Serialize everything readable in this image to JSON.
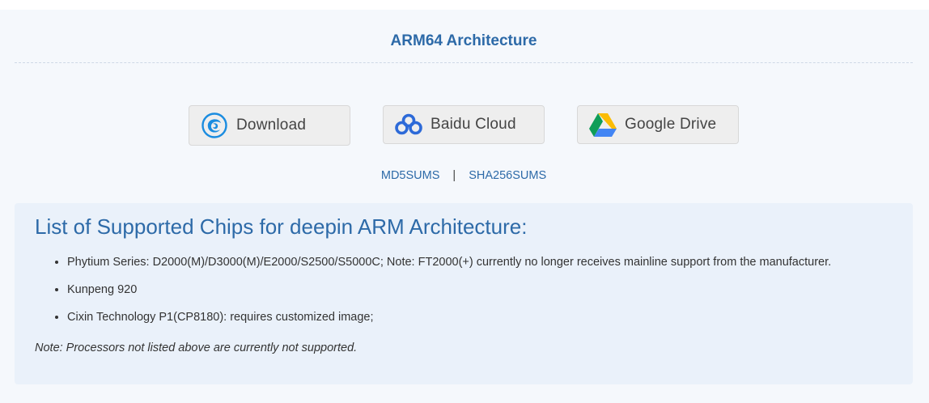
{
  "section": {
    "title": "ARM64 Architecture"
  },
  "downloads": [
    {
      "label": "Download",
      "icon": "deepin-logo-icon"
    },
    {
      "label": "Baidu Cloud",
      "icon": "baidu-cloud-icon"
    },
    {
      "label": "Google Drive",
      "icon": "google-drive-icon"
    }
  ],
  "checksums": {
    "md5": "MD5SUMS",
    "separator": "|",
    "sha256": "SHA256SUMS"
  },
  "chips": {
    "heading": "List of Supported Chips for deepin ARM Architecture:",
    "items": [
      "Phytium Series: D2000(M)/D3000(M)/E2000/S2500/S5000C; Note: FT2000(+) currently no longer receives mainline support from the manufacturer.",
      "Kunpeng 920",
      "Cixin Technology P1(CP8180): requires customized image;"
    ],
    "note": "Note: Processors not listed above are currently not supported."
  },
  "colors": {
    "accent": "#2d6aa8",
    "panel_bg": "#f5f8fc",
    "chips_bg": "#eaf1fa",
    "button_bg": "#eeeeee"
  }
}
